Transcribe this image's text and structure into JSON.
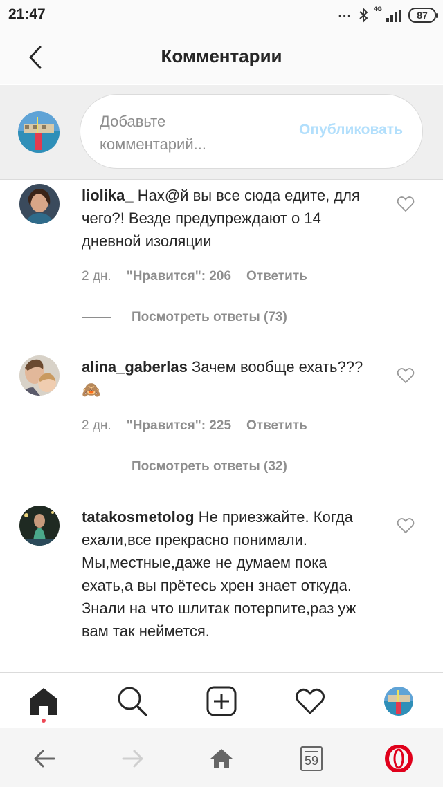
{
  "status_bar": {
    "time": "21:47",
    "dots": "...",
    "network": "4G",
    "battery": "87"
  },
  "header": {
    "title": "Комментарии",
    "back_icon": "chevron-left-icon"
  },
  "composer": {
    "placeholder": "Добавьте комментарий...",
    "publish_label": "Опубликовать"
  },
  "comments": [
    {
      "username": "liolika_",
      "text": " Нах@й вы все сюда едите, для чего?! Везде предупреждают о 14 дневной изоляции",
      "time": "2 дн.",
      "likes": "\"Нравится\": 206",
      "reply_label": "Ответить",
      "view_replies": "Посмотреть ответы (73)"
    },
    {
      "username": "alina_gaberlas",
      "text": " Зачем вообще ехать???🙈",
      "time": "2 дн.",
      "likes": "\"Нравится\": 225",
      "reply_label": "Ответить",
      "view_replies": "Посмотреть ответы (32)"
    },
    {
      "username": "tatakosmetolog",
      "text": " Не приезжайте. Когда ехали,все прекрасно понимали. Мы,местные,даже не думаем пока ехать,а вы прётесь хрен знает откуда. Знали на что шлитак потерпите,раз уж вам так неймется."
    }
  ],
  "app_nav": {
    "items": [
      "home-icon",
      "search-icon",
      "add-post-icon",
      "activity-heart-icon",
      "profile-avatar"
    ]
  },
  "browser_nav": {
    "tab_count": "59",
    "items": [
      "back-arrow-icon",
      "forward-arrow-icon",
      "home-icon",
      "tabs-icon",
      "opera-logo-icon"
    ]
  },
  "colors": {
    "accent_disabled": "#b2dffc",
    "text_primary": "#262626",
    "text_secondary": "#8e8e8e",
    "notification_dot": "#ed4956",
    "opera_red": "#e0001b"
  }
}
